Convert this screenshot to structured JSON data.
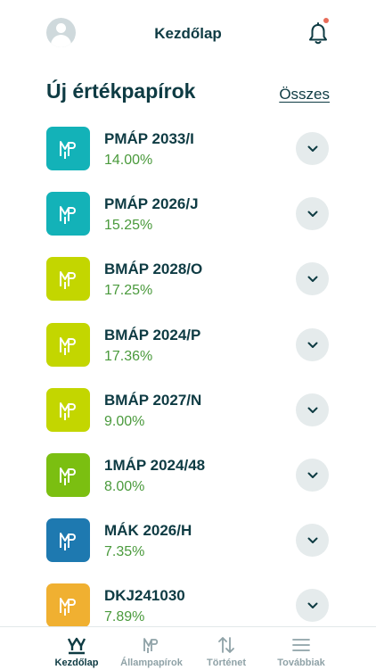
{
  "header": {
    "title": "Kezdőlap"
  },
  "section": {
    "title": "Új értékpapírok",
    "all_link": "Összes"
  },
  "securities": [
    {
      "name": "PMÁP 2033/I",
      "rate": "14.00%",
      "color": "#13b2b8"
    },
    {
      "name": "PMÁP 2026/J",
      "rate": "15.25%",
      "color": "#13b2b8"
    },
    {
      "name": "BMÁP 2028/O",
      "rate": "17.25%",
      "color": "#c3d600"
    },
    {
      "name": "BMÁP 2024/P",
      "rate": "17.36%",
      "color": "#c3d600"
    },
    {
      "name": "BMÁP 2027/N",
      "rate": "9.00%",
      "color": "#c3d600"
    },
    {
      "name": "1MÁP 2024/48",
      "rate": "8.00%",
      "color": "#7bbf11"
    },
    {
      "name": "MÁK 2026/H",
      "rate": "7.35%",
      "color": "#1e79b0"
    },
    {
      "name": "DKJ241030",
      "rate": "7.89%",
      "color": "#f0b031"
    }
  ],
  "tabbar": {
    "items": [
      {
        "label": "Kezdőlap",
        "icon": "home-logo-icon",
        "active": true
      },
      {
        "label": "Állampapírok",
        "icon": "securities-logo-icon",
        "active": false
      },
      {
        "label": "Történet",
        "icon": "arrows-up-down-icon",
        "active": false
      },
      {
        "label": "Továbbiak",
        "icon": "menu-icon",
        "active": false
      }
    ]
  },
  "colors": {
    "text": "#0e3b43",
    "rate_green": "#4a9a3c",
    "chevron_bg": "#e5ebec",
    "notification_dot": "#e86c5a"
  }
}
